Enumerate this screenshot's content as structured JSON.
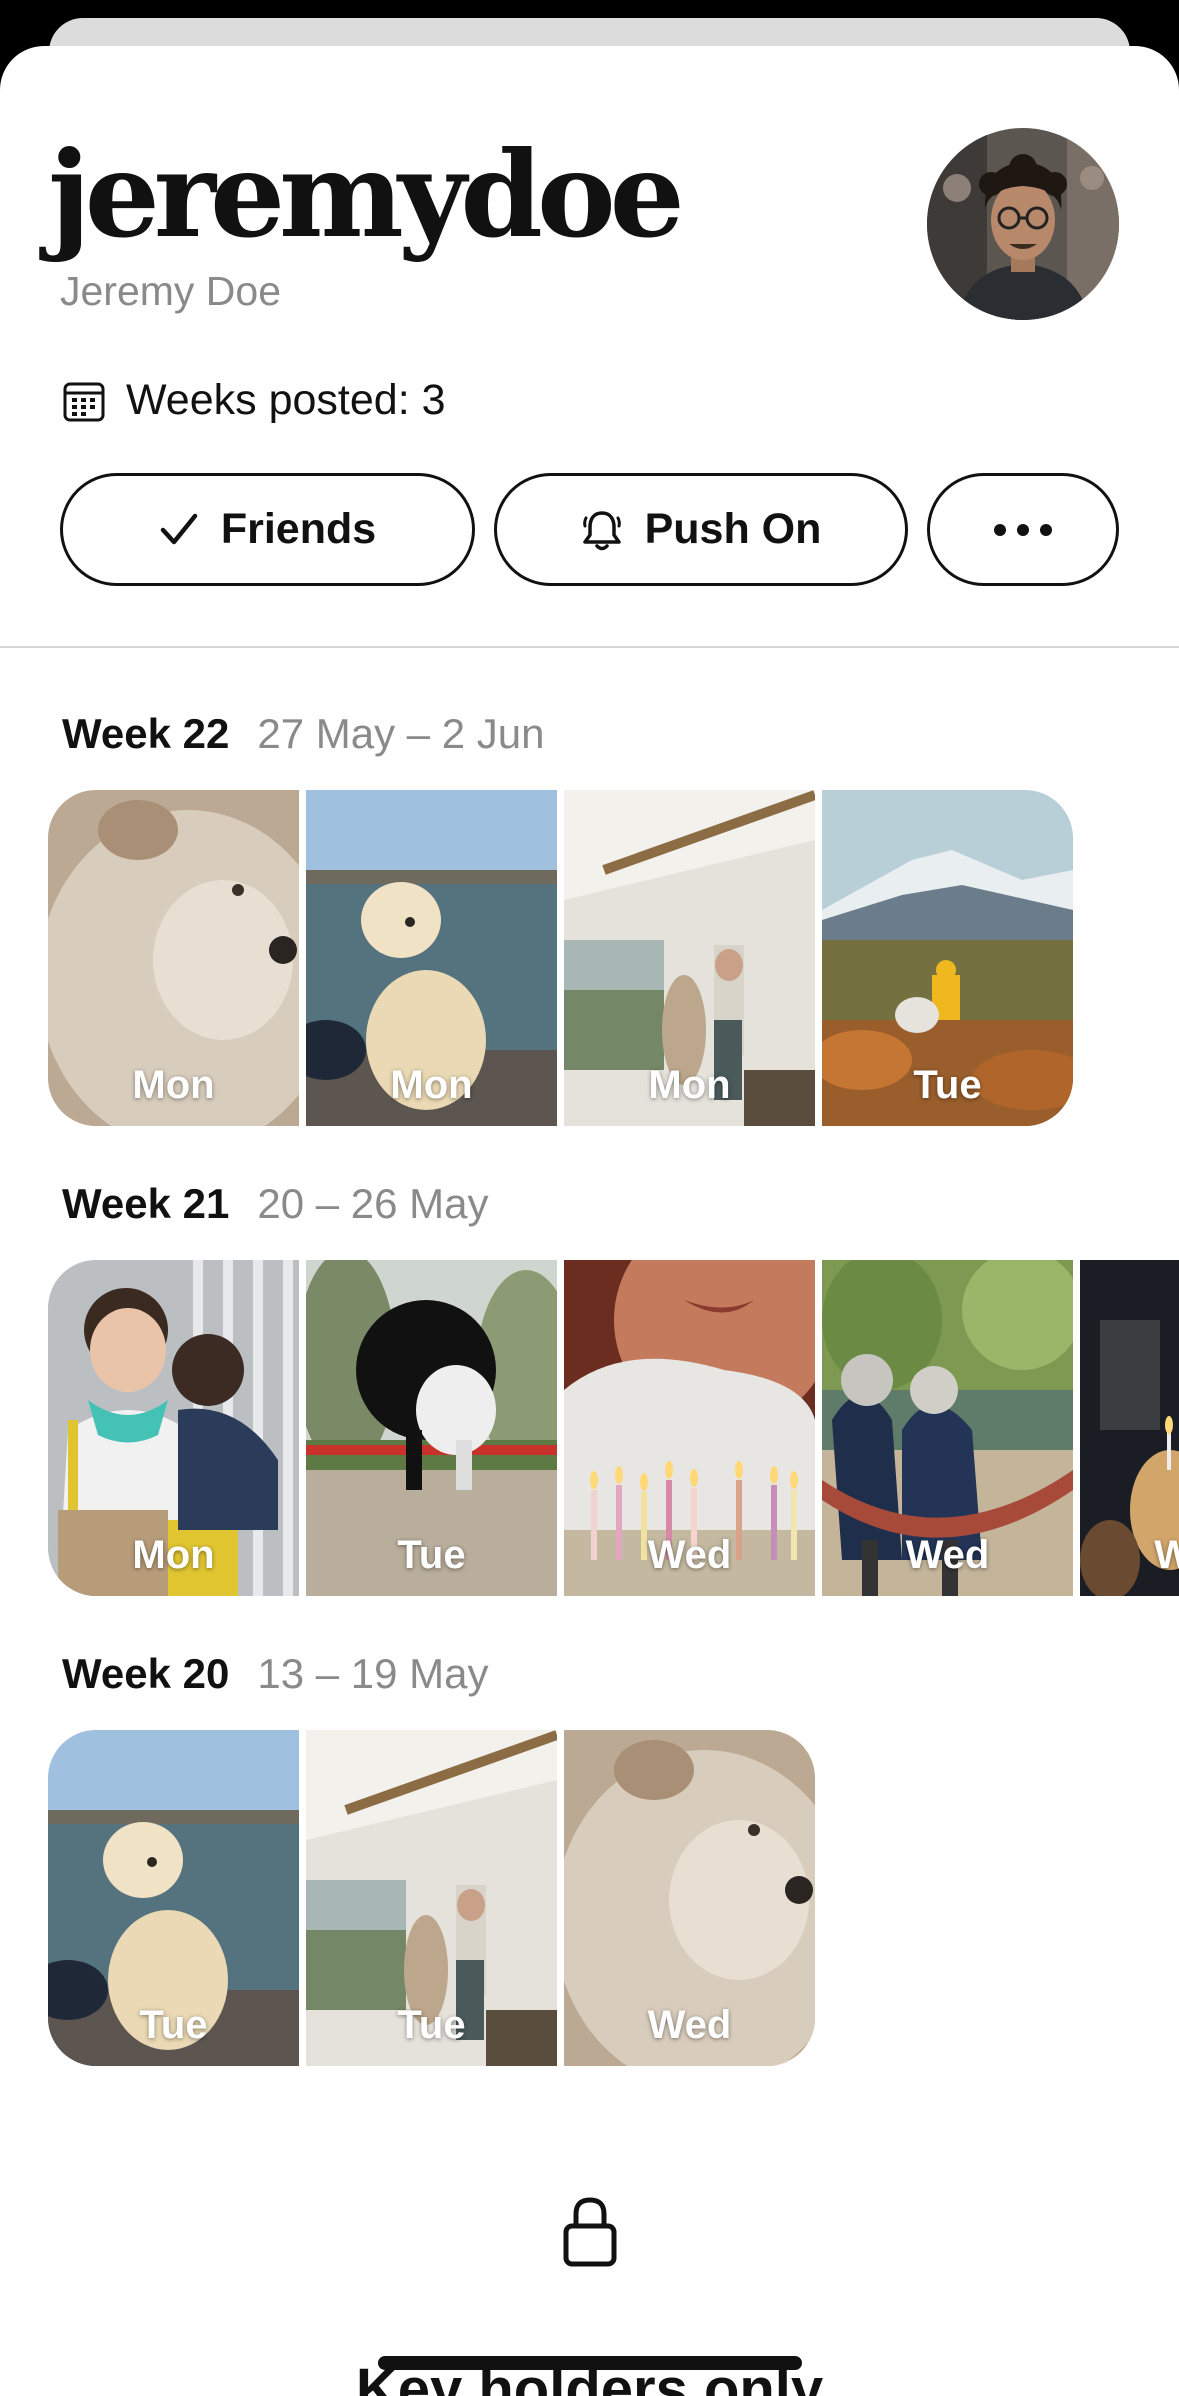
{
  "profile": {
    "username": "jeremydoe",
    "full_name": "Jeremy Doe",
    "weeks_posted": "Weeks posted: 3"
  },
  "actions": {
    "friends_label": "Friends",
    "push_label": "Push On",
    "more_icon": "ellipsis-icon"
  },
  "weeks": [
    {
      "title": "Week 22",
      "range": "27 May – 2 Jun",
      "days": [
        "Mon",
        "Mon",
        "Mon",
        "Tue"
      ]
    },
    {
      "title": "Week 21",
      "range": "20 – 26 May",
      "days": [
        "Mon",
        "Tue",
        "Wed",
        "Wed",
        "W"
      ]
    },
    {
      "title": "Week 20",
      "range": "13 – 19 May",
      "days": [
        "Tue",
        "Tue",
        "Wed"
      ]
    }
  ],
  "locked": {
    "icon": "lock-icon",
    "title": "Key holders only"
  }
}
